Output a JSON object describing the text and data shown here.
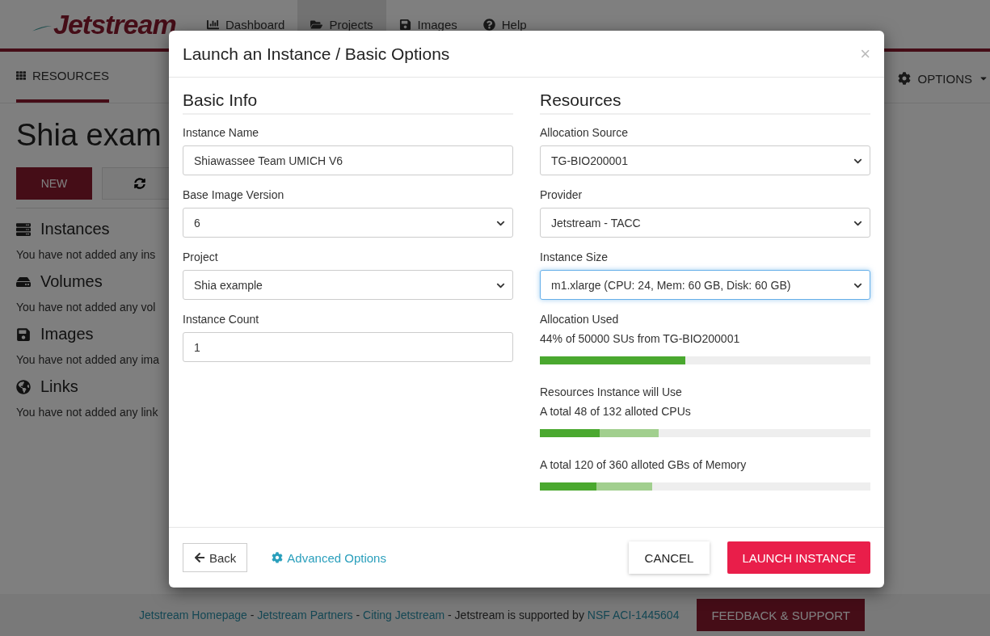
{
  "header": {
    "logo": "Jetstream",
    "nav": [
      {
        "label": "Dashboard",
        "selected": false
      },
      {
        "label": "Projects",
        "selected": true
      },
      {
        "label": "Images",
        "selected": false
      },
      {
        "label": "Help",
        "selected": false
      }
    ]
  },
  "subnav": {
    "tabs": [
      {
        "label": "RESOURCES",
        "selected": true
      }
    ],
    "options": "OPTIONS"
  },
  "page": {
    "title": "Shia exam",
    "new_button": "NEW",
    "sections": [
      {
        "title": "Instances",
        "text": "You have not added any ins"
      },
      {
        "title": "Volumes",
        "text": "You have not added any vol"
      },
      {
        "title": "Images",
        "text": "You have not added any ima"
      },
      {
        "title": "Links",
        "text": "You have not added any link"
      }
    ]
  },
  "footer": {
    "parts": [
      {
        "kind": "link",
        "text": "Jetstream Homepage"
      },
      {
        "kind": "text",
        "text": " - "
      },
      {
        "kind": "link",
        "text": "Jetstream Partners"
      },
      {
        "kind": "text",
        "text": " - "
      },
      {
        "kind": "link",
        "text": "Citing Jetstream"
      },
      {
        "kind": "text",
        "text": " - Jetstream is supported by "
      },
      {
        "kind": "link",
        "text": "NSF ACI-1445604"
      }
    ],
    "button": "FEEDBACK & SUPPORT"
  },
  "modal": {
    "title": "Launch an Instance / Basic Options",
    "close": "×",
    "left": {
      "heading": "Basic Info",
      "fields": [
        {
          "kind": "input",
          "label": "Instance Name",
          "value": "Shiawassee Team UMICH V6",
          "focused": false
        },
        {
          "kind": "select",
          "label": "Base Image Version",
          "value": "6",
          "focused": false
        },
        {
          "kind": "select",
          "label": "Project",
          "value": "Shia example",
          "focused": false
        },
        {
          "kind": "input",
          "label": "Instance Count",
          "value": "1",
          "focused": false
        }
      ]
    },
    "right": {
      "heading": "Resources",
      "fields": [
        {
          "kind": "select",
          "label": "Allocation Source",
          "value": "TG-BIO200001",
          "focused": false
        },
        {
          "kind": "select",
          "label": "Provider",
          "value": "Jetstream - TACC",
          "focused": false
        },
        {
          "kind": "select",
          "label": "Instance Size",
          "value": "m1.xlarge (CPU: 24, Mem: 60 GB, Disk: 60 GB)",
          "focused": true
        }
      ],
      "usage": [
        {
          "title": "Allocation Used",
          "text": "44% of 50000 SUs from TG-BIO200001",
          "segments": [
            {
              "kind": "current",
              "level": 0.44
            }
          ]
        },
        {
          "title": "Resources Instance will Use",
          "text": "A total 48 of 132 alloted CPUs",
          "segments": [
            {
              "kind": "current",
              "level": 0.18
            },
            {
              "kind": "added",
              "level": 0.18
            }
          ]
        },
        {
          "text": "A total 120 of 360 alloted GBs of Memory",
          "segments": [
            {
              "kind": "current",
              "level": 0.17
            },
            {
              "kind": "added",
              "level": 0.17
            }
          ]
        }
      ]
    },
    "back": "Back",
    "advanced": "Advanced Options",
    "cancel": "CANCEL",
    "launch": "LAUNCH INSTANCE"
  }
}
